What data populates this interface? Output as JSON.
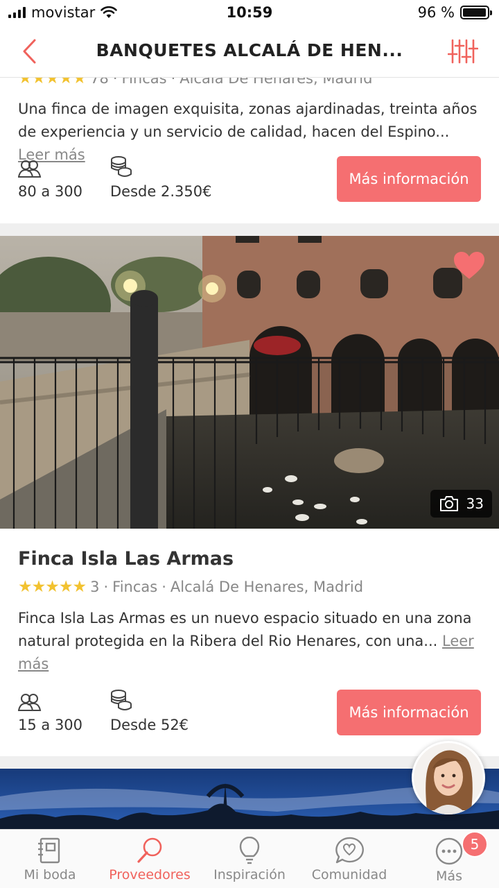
{
  "status_bar": {
    "carrier": "movistar",
    "time": "10:59",
    "battery_text": "96 %",
    "battery_level": 0.96
  },
  "nav": {
    "title": "BANQUETES ALCALÁ DE HEN...",
    "back_icon": "chevron-left-icon",
    "filter_icon": "sliders-icon",
    "accent": "#f0625c"
  },
  "listings": [
    {
      "rating_count": "78",
      "category": "Fincas",
      "location": "Alcalá De Henares, Madrid",
      "description": "Una finca de imagen exquisita, zonas ajardinadas, treinta años de experiencia y un servicio de calidad, hacen del Espino...",
      "read_more": "Leer más",
      "guests": "80 a 300",
      "price": "Desde 2.350€",
      "cta": "Más información"
    },
    {
      "title": "Finca Isla Las Armas",
      "stars": "★★★★★",
      "rating_count": "3",
      "category": "Fincas",
      "location": "Alcalá De Henares, Madrid",
      "description": "Finca Isla Las Armas es un nuevo espacio situado en una zona natural protegida en la Ribera del Rio Henares, con una...",
      "read_more": "Leer más",
      "guests": "15 a 300",
      "price": "Desde 52€",
      "cta": "Más información",
      "photo_count": "33"
    }
  ],
  "tabs": [
    {
      "label": "Mi boda",
      "icon": "notebook-icon"
    },
    {
      "label": "Proveedores",
      "icon": "search-icon",
      "active": true
    },
    {
      "label": "Inspiración",
      "icon": "lightbulb-icon"
    },
    {
      "label": "Comunidad",
      "icon": "chat-heart-icon"
    },
    {
      "label": "Más",
      "icon": "more-icon",
      "badge": "5"
    }
  ]
}
